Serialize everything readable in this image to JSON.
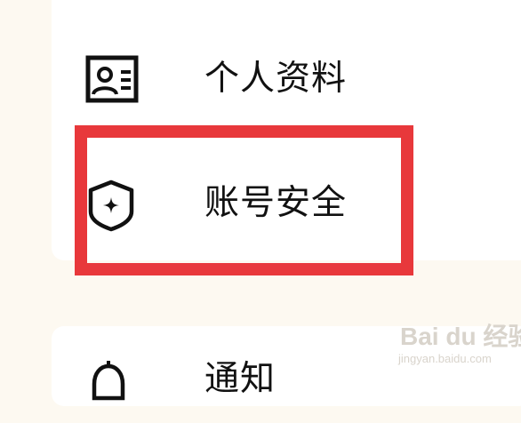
{
  "menu": {
    "items": [
      {
        "label": "个人资料",
        "icon": "profile-card-icon"
      },
      {
        "label": "账号安全",
        "icon": "shield-icon"
      },
      {
        "label": "通知",
        "icon": "bell-icon"
      }
    ]
  },
  "annotation": {
    "highlight_color": "#e8383b",
    "highlighted_item": "账号安全"
  },
  "watermark": {
    "main": "Bai du 经验",
    "sub": "jingyan.baidu.com"
  },
  "colors": {
    "background": "#fdf9f1",
    "card": "#ffffff",
    "text": "#111111"
  }
}
